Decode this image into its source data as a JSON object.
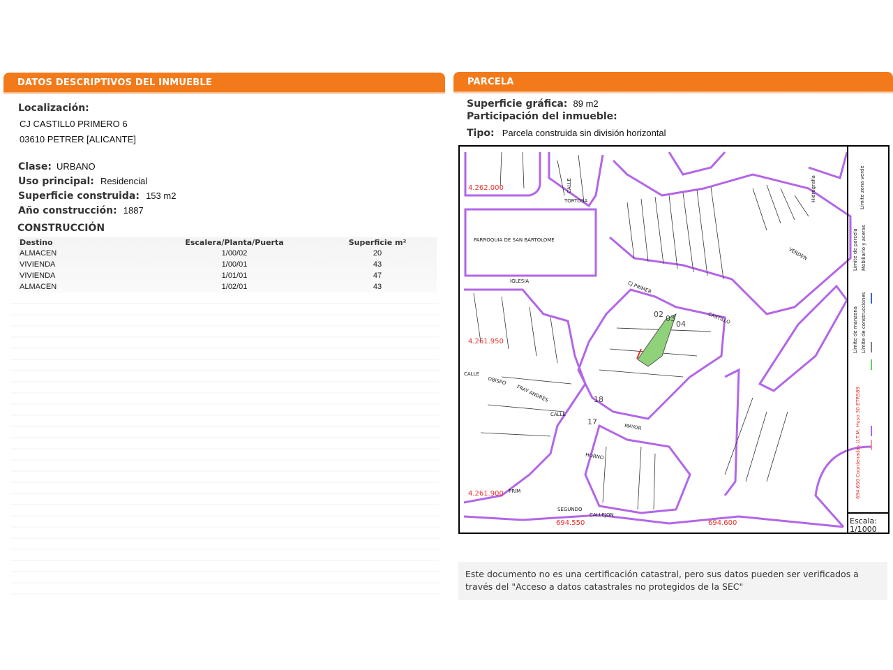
{
  "left": {
    "header": "DATOS DESCRIPTIVOS DEL INMUEBLE",
    "localizacion_label": "Localización:",
    "address_line1": "CJ CASTILL0 PRIMERO 6",
    "address_line2": "03610 PETRER [ALICANTE]",
    "clase_label": "Clase:",
    "clase_value": "URBANO",
    "uso_label": "Uso principal:",
    "uso_value": "Residencial",
    "superficie_label": "Superficie construida:",
    "superficie_value": "153 m2",
    "anio_label": "Año construcción:",
    "anio_value": "1887",
    "construccion_title": "CONSTRUCCIÓN",
    "table": {
      "headers": [
        "Destino",
        "Escalera/Planta/Puerta",
        "Superficie m²"
      ],
      "rows": [
        [
          "ALMACEN",
          "1/00/02",
          "20"
        ],
        [
          "VIVIENDA",
          "1/00/01",
          "43"
        ],
        [
          "VIVIENDA",
          "1/01/01",
          "47"
        ],
        [
          "ALMACEN",
          "1/02/01",
          "43"
        ]
      ]
    }
  },
  "right": {
    "header": "PARCELA",
    "superficie_label": "Superficie gráfica:",
    "superficie_value": "89 m2",
    "participacion_label": "Participación del inmueble:",
    "tipo_label": "Tipo:",
    "tipo_value": "Parcela construida sin división horizontal",
    "map": {
      "coord_labels": [
        "4.262.000",
        "4.261.950",
        "4.261.900",
        "694.550",
        "694.600"
      ],
      "street_labels": [
        "CALLE",
        "TORTOSA",
        "PARROQUIA DE SAN BARTOLOME",
        "IGLESIA",
        "CJ PRIMER",
        "CASTILLO",
        "CALLE",
        "OBISPO",
        "FRAY ANDRES",
        "MAYOR",
        "CALLE",
        "HORNO",
        "SEGUNDO",
        "CALLEJON",
        "PRIM",
        "VERDEN"
      ],
      "parcel_numbers": [
        "02",
        "03",
        "04",
        "18",
        "17"
      ],
      "legend": [
        "Hidrografía",
        "Límite zona verde",
        "Límite de parcela",
        "Mobiliario y aceras",
        "Límite de manzana",
        "Límite de construcciones"
      ],
      "projection": "694.650 Coordenadas U.T.M. Huso 30 ETRS89",
      "scale_label": "Escala:",
      "scale_value": "1/1000",
      "colors": {
        "block": "#b366e6",
        "coord": "#e8302a",
        "number": "#2a3ed8",
        "parcel": "#8fd27a"
      }
    }
  },
  "disclaimer": "Este documento no es una certificación catastral, pero sus datos pueden ser verificados a través del \"Acceso a datos catastrales no protegidos de la SEC\""
}
